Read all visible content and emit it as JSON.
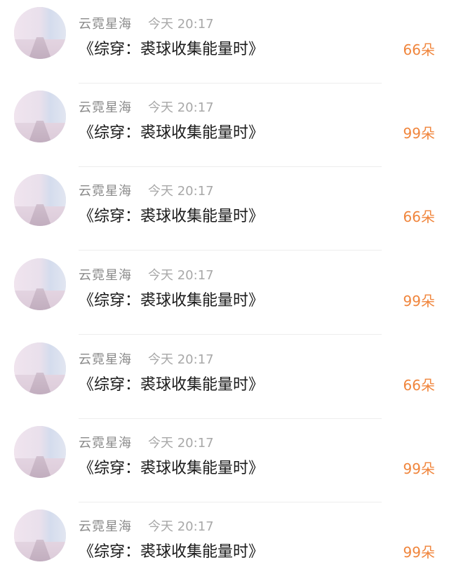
{
  "messages": [
    {
      "user": "云霓星海",
      "time": "今天 20:17",
      "title": "《综穿：裘球收集能量时》",
      "flowers": "66朵"
    },
    {
      "user": "云霓星海",
      "time": "今天 20:17",
      "title": "《综穿：裘球收集能量时》",
      "flowers": "99朵"
    },
    {
      "user": "云霓星海",
      "time": "今天 20:17",
      "title": "《综穿：裘球收集能量时》",
      "flowers": "66朵"
    },
    {
      "user": "云霓星海",
      "time": "今天 20:17",
      "title": "《综穿：裘球收集能量时》",
      "flowers": "99朵"
    },
    {
      "user": "云霓星海",
      "time": "今天 20:17",
      "title": "《综穿：裘球收集能量时》",
      "flowers": "66朵"
    },
    {
      "user": "云霓星海",
      "time": "今天 20:17",
      "title": "《综穿：裘球收集能量时》",
      "flowers": "99朵"
    },
    {
      "user": "云霓星海",
      "time": "今天 20:17",
      "title": "《综穿：裘球收集能量时》",
      "flowers": "99朵"
    }
  ],
  "colors": {
    "username": "#8a8a8a",
    "time": "#a8a8a8",
    "title": "#1a1a1a",
    "flowers": "#f0853c",
    "divider": "#ededed"
  }
}
